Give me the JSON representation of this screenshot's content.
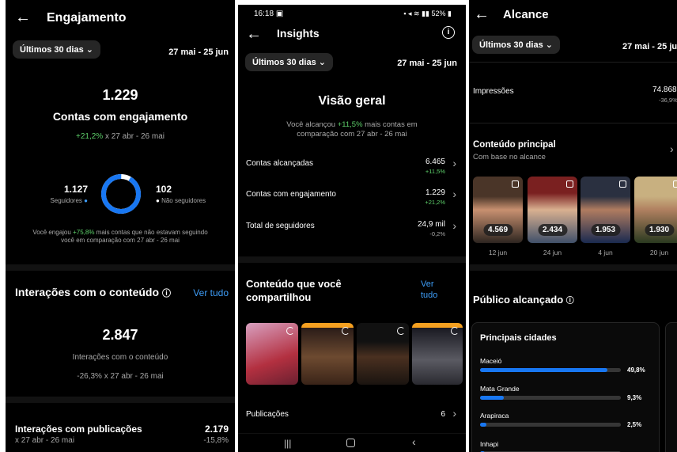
{
  "p1": {
    "title": "Engajamento",
    "range_chip": "Últimos 30 dias",
    "date_range": "27 mai - 25 jun",
    "accounts_value": "1.229",
    "accounts_label": "Contas com engajamento",
    "accounts_change": "+21,2%",
    "accounts_compare": "x 27 abr - 26 mai",
    "followers_value": "1.127",
    "followers_label": "Seguidores",
    "nonfollowers_value": "102",
    "nonfollowers_label": "Não seguidores",
    "followers_share": 0.917,
    "note_prefix": "Você engajou",
    "note_pct": "+75,8%",
    "note_suffix": "mais contas que não estavam seguindo",
    "note_line2": "você em comparação com 27 abr - 26 mai",
    "interactions_title": "Interações com o conteúdo",
    "see_all": "Ver tudo",
    "interactions_value": "2.847",
    "interactions_label": "Interações com o conteúdo",
    "interactions_change": "-26,3% x 27 abr - 26 mai",
    "posts_title": "Interações com publicações",
    "posts_value": "2.179",
    "posts_compare": "x 27 abr - 26 mai",
    "posts_change": "-15,8%"
  },
  "p2": {
    "status_time": "16:18",
    "status_battery": "52%",
    "title": "Insights",
    "range_chip": "Últimos 30 dias",
    "date_range": "27 mai - 25 jun",
    "overview_title": "Visão geral",
    "overview_prefix": "Você alcançou",
    "overview_pct": "+11,5%",
    "overview_suffix": "mais contas em",
    "overview_line2": "comparação com 27 abr - 26 mai",
    "rows": [
      {
        "label": "Contas alcançadas",
        "value": "6.465",
        "change": "+11,5%"
      },
      {
        "label": "Contas com engajamento",
        "value": "1.229",
        "change": "+21,2%"
      },
      {
        "label": "Total de seguidores",
        "value": "24,9 mil",
        "change": "-0,2%"
      }
    ],
    "shared_title_1": "Conteúdo que você",
    "shared_title_2": "compartilhou",
    "see_all_1": "Ver",
    "see_all_2": "tudo",
    "posts_label": "Publicações",
    "posts_value": "6"
  },
  "p3": {
    "title": "Alcance",
    "range_chip": "Últimos 30 dias",
    "date_range": "27 mai - 25 jun",
    "impressions_label": "Impressões",
    "impressions_value": "74.868",
    "impressions_change": "-36,9%",
    "top_content_title": "Conteúdo principal",
    "top_content_sub": "Com base no alcance",
    "thumbs": [
      {
        "count": "4.569",
        "date": "12 jun"
      },
      {
        "count": "2.434",
        "date": "24 jun"
      },
      {
        "count": "1.953",
        "date": "4 jun"
      },
      {
        "count": "1.930",
        "date": "20 jun"
      }
    ],
    "audience_title": "Público alcançado",
    "cities_title": "Principais cidades",
    "cities": [
      {
        "name": "Maceió",
        "pct": "49,8%",
        "fraction": 0.498
      },
      {
        "name": "Mata Grande",
        "pct": "9,3%",
        "fraction": 0.093
      },
      {
        "name": "Arapiraca",
        "pct": "2,5%",
        "fraction": 0.025
      },
      {
        "name": "Inhapi",
        "pct": "",
        "fraction": 0.02
      }
    ]
  },
  "colors": {
    "accent": "#1877f2",
    "positive": "#5dcf6a",
    "link": "#3d9cf6",
    "ring_minor": "#ffffff"
  }
}
